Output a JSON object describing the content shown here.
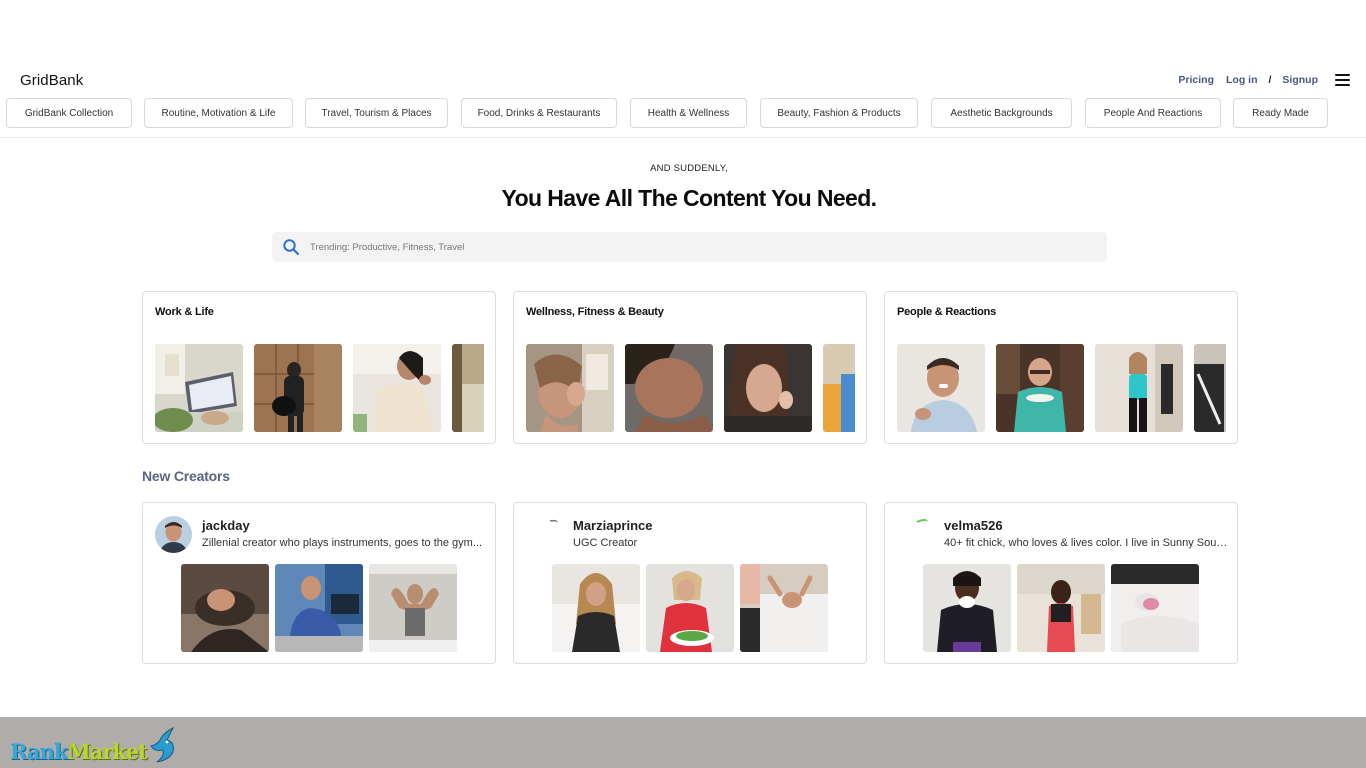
{
  "header": {
    "brand": "GridBank",
    "nav": {
      "pricing": "Pricing",
      "login": "Log in",
      "separator": "/",
      "signup": "Signup"
    },
    "menu_icon": "hamburger-menu-icon",
    "categories": [
      "GridBank Collection",
      "Routine, Motivation & Life",
      "Travel, Tourism & Places",
      "Food, Drinks & Restaurants",
      "Health & Wellness",
      "Beauty, Fashion & Products",
      "Aesthetic Backgrounds",
      "People And Reactions",
      "Ready Made"
    ]
  },
  "hero": {
    "eyebrow": "AND SUDDENLY,",
    "headline": "You Have All The Content You Need.",
    "search_placeholder": "Trending: Productive, Fitness, Travel",
    "search_icon": "search-icon"
  },
  "collections": [
    {
      "title": "Work & Life"
    },
    {
      "title": "Wellness, Fitness & Beauty"
    },
    {
      "title": "People & Reactions"
    }
  ],
  "creators_heading": "New Creators",
  "creators": [
    {
      "name": "jackday",
      "bio": "Zillenial creator who plays instruments, goes to the gym..."
    },
    {
      "name": "Marziaprince",
      "bio": "UGC Creator"
    },
    {
      "name": "velma526",
      "bio": "40+ fit chick, who loves & lives color. I live in Sunny Sout..."
    }
  ],
  "footer": {
    "logo_word_1": "Rank",
    "logo_word_2": "Market"
  },
  "colors": {
    "nav_link": "#4a5580",
    "section_heading": "#5b6480",
    "search_icon": "#2e6fd6",
    "footer_bg": "#b0acaa"
  }
}
